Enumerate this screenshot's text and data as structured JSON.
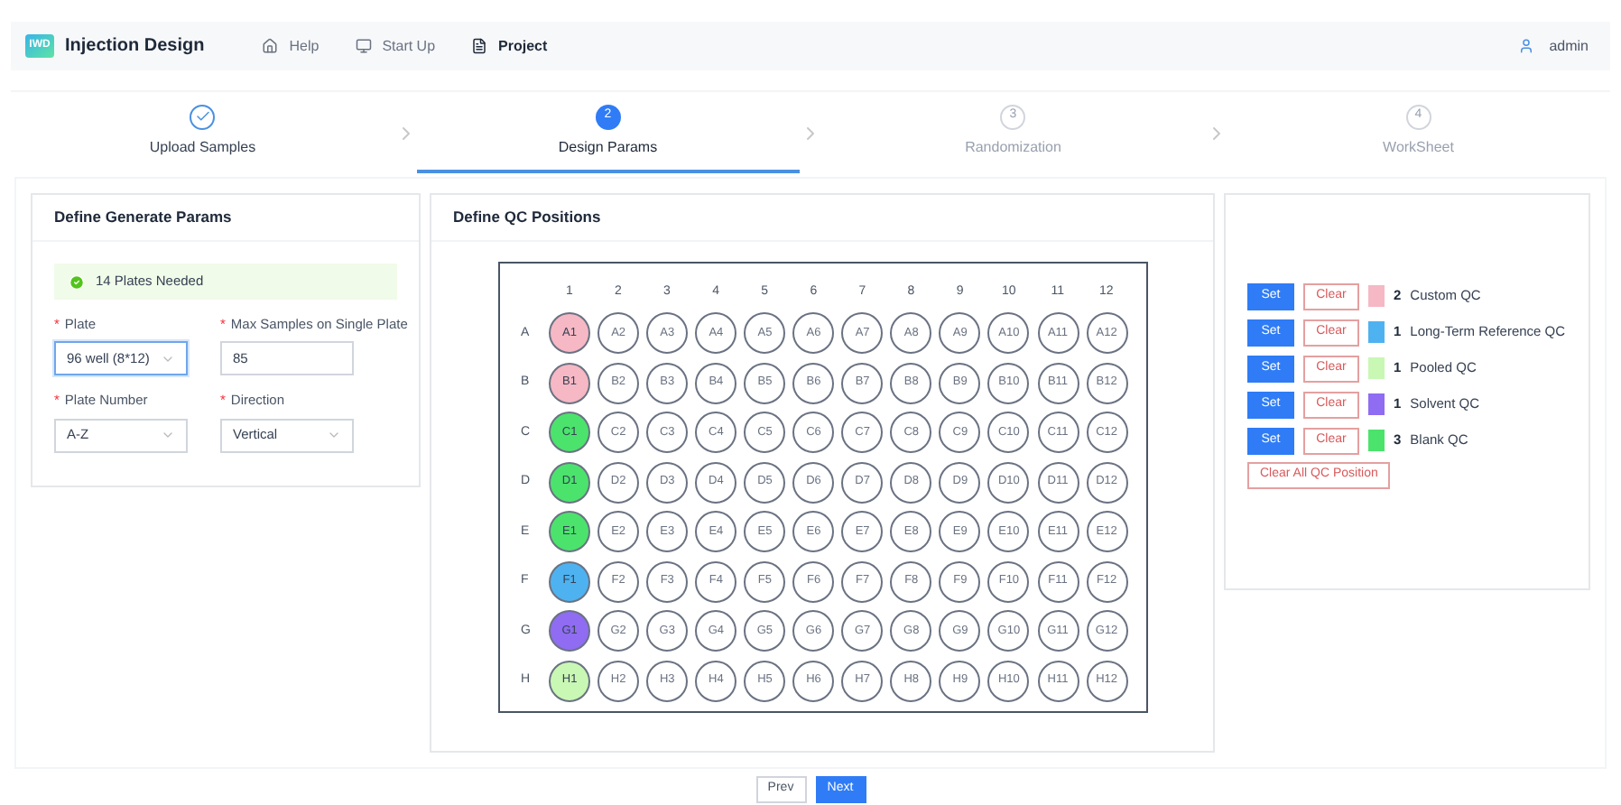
{
  "app": {
    "title": "Injection Design",
    "logo": "IWD",
    "nav": [
      {
        "label": "Help",
        "selected": false
      },
      {
        "label": "Start Up",
        "selected": false
      },
      {
        "label": "Project",
        "selected": true
      }
    ],
    "user": "admin"
  },
  "steps": [
    {
      "label": "Upload Samples",
      "done": true,
      "selected": false
    },
    {
      "label": "Design Params",
      "number": "2",
      "done": false,
      "selected": true
    },
    {
      "label": "Randomization",
      "number": "3",
      "done": false,
      "selected": false
    },
    {
      "label": "WorkSheet",
      "number": "4",
      "done": false,
      "selected": false
    }
  ],
  "params": {
    "title": "Define Generate Params",
    "alert": "14 Plates Needed",
    "fields": [
      {
        "required": "*",
        "label": "Plate",
        "kind": "select",
        "value": "96 well (8*12)",
        "focused": true
      },
      {
        "required": "*",
        "label": "Max Samples on Single Plate",
        "kind": "input",
        "value": "85",
        "focused": false
      },
      {
        "required": "*",
        "label": "Plate Number",
        "kind": "select",
        "value": "A-Z",
        "focused": false
      },
      {
        "required": "*",
        "label": "Direction",
        "kind": "select",
        "value": "Vertical",
        "focused": false
      }
    ]
  },
  "qc_positions": {
    "title": "Define QC Positions",
    "columns": [
      "1",
      "2",
      "3",
      "4",
      "5",
      "6",
      "7",
      "8",
      "9",
      "10",
      "11",
      "12"
    ],
    "rows": [
      {
        "label": "A",
        "wells": [
          {
            "label": "A1",
            "color": "#f5b8c4"
          },
          {
            "label": "A2"
          },
          {
            "label": "A3"
          },
          {
            "label": "A4"
          },
          {
            "label": "A5"
          },
          {
            "label": "A6"
          },
          {
            "label": "A7"
          },
          {
            "label": "A8"
          },
          {
            "label": "A9"
          },
          {
            "label": "A10"
          },
          {
            "label": "A11"
          },
          {
            "label": "A12"
          }
        ]
      },
      {
        "label": "B",
        "wells": [
          {
            "label": "B1",
            "color": "#f5b8c4"
          },
          {
            "label": "B2"
          },
          {
            "label": "B3"
          },
          {
            "label": "B4"
          },
          {
            "label": "B5"
          },
          {
            "label": "B6"
          },
          {
            "label": "B7"
          },
          {
            "label": "B8"
          },
          {
            "label": "B9"
          },
          {
            "label": "B10"
          },
          {
            "label": "B11"
          },
          {
            "label": "B12"
          }
        ]
      },
      {
        "label": "C",
        "wells": [
          {
            "label": "C1",
            "color": "#4be36c"
          },
          {
            "label": "C2"
          },
          {
            "label": "C3"
          },
          {
            "label": "C4"
          },
          {
            "label": "C5"
          },
          {
            "label": "C6"
          },
          {
            "label": "C7"
          },
          {
            "label": "C8"
          },
          {
            "label": "C9"
          },
          {
            "label": "C10"
          },
          {
            "label": "C11"
          },
          {
            "label": "C12"
          }
        ]
      },
      {
        "label": "D",
        "wells": [
          {
            "label": "D1",
            "color": "#4be36c"
          },
          {
            "label": "D2"
          },
          {
            "label": "D3"
          },
          {
            "label": "D4"
          },
          {
            "label": "D5"
          },
          {
            "label": "D6"
          },
          {
            "label": "D7"
          },
          {
            "label": "D8"
          },
          {
            "label": "D9"
          },
          {
            "label": "D10"
          },
          {
            "label": "D11"
          },
          {
            "label": "D12"
          }
        ]
      },
      {
        "label": "E",
        "wells": [
          {
            "label": "E1",
            "color": "#4be36c"
          },
          {
            "label": "E2"
          },
          {
            "label": "E3"
          },
          {
            "label": "E4"
          },
          {
            "label": "E5"
          },
          {
            "label": "E6"
          },
          {
            "label": "E7"
          },
          {
            "label": "E8"
          },
          {
            "label": "E9"
          },
          {
            "label": "E10"
          },
          {
            "label": "E11"
          },
          {
            "label": "E12"
          }
        ]
      },
      {
        "label": "F",
        "wells": [
          {
            "label": "F1",
            "color": "#4eb2f0"
          },
          {
            "label": "F2"
          },
          {
            "label": "F3"
          },
          {
            "label": "F4"
          },
          {
            "label": "F5"
          },
          {
            "label": "F6"
          },
          {
            "label": "F7"
          },
          {
            "label": "F8"
          },
          {
            "label": "F9"
          },
          {
            "label": "F10"
          },
          {
            "label": "F11"
          },
          {
            "label": "F12"
          }
        ]
      },
      {
        "label": "G",
        "wells": [
          {
            "label": "G1",
            "color": "#8f6cf2"
          },
          {
            "label": "G2"
          },
          {
            "label": "G3"
          },
          {
            "label": "G4"
          },
          {
            "label": "G5"
          },
          {
            "label": "G6"
          },
          {
            "label": "G7"
          },
          {
            "label": "G8"
          },
          {
            "label": "G9"
          },
          {
            "label": "G10"
          },
          {
            "label": "G11"
          },
          {
            "label": "G12"
          }
        ]
      },
      {
        "label": "H",
        "wells": [
          {
            "label": "H1",
            "color": "#c9f7b4"
          },
          {
            "label": "H2"
          },
          {
            "label": "H3"
          },
          {
            "label": "H4"
          },
          {
            "label": "H5"
          },
          {
            "label": "H6"
          },
          {
            "label": "H7"
          },
          {
            "label": "H8"
          },
          {
            "label": "H9"
          },
          {
            "label": "H10"
          },
          {
            "label": "H11"
          },
          {
            "label": "H12"
          }
        ]
      }
    ]
  },
  "qc_types": {
    "items": [
      {
        "set": "Set",
        "clear": "Clear",
        "count": "2",
        "name": "Custom QC",
        "color": "#f5b8c4"
      },
      {
        "set": "Set",
        "clear": "Clear",
        "count": "1",
        "name": "Long-Term Reference QC",
        "color": "#4eb2f0"
      },
      {
        "set": "Set",
        "clear": "Clear",
        "count": "1",
        "name": "Pooled QC",
        "color": "#c9f7b4"
      },
      {
        "set": "Set",
        "clear": "Clear",
        "count": "1",
        "name": "Solvent QC",
        "color": "#8f6cf2"
      },
      {
        "set": "Set",
        "clear": "Clear",
        "count": "3",
        "name": "Blank QC",
        "color": "#4be36c"
      }
    ],
    "clear_all": "Clear All QC Position"
  },
  "footer": {
    "prev": "Prev",
    "next": "Next"
  }
}
